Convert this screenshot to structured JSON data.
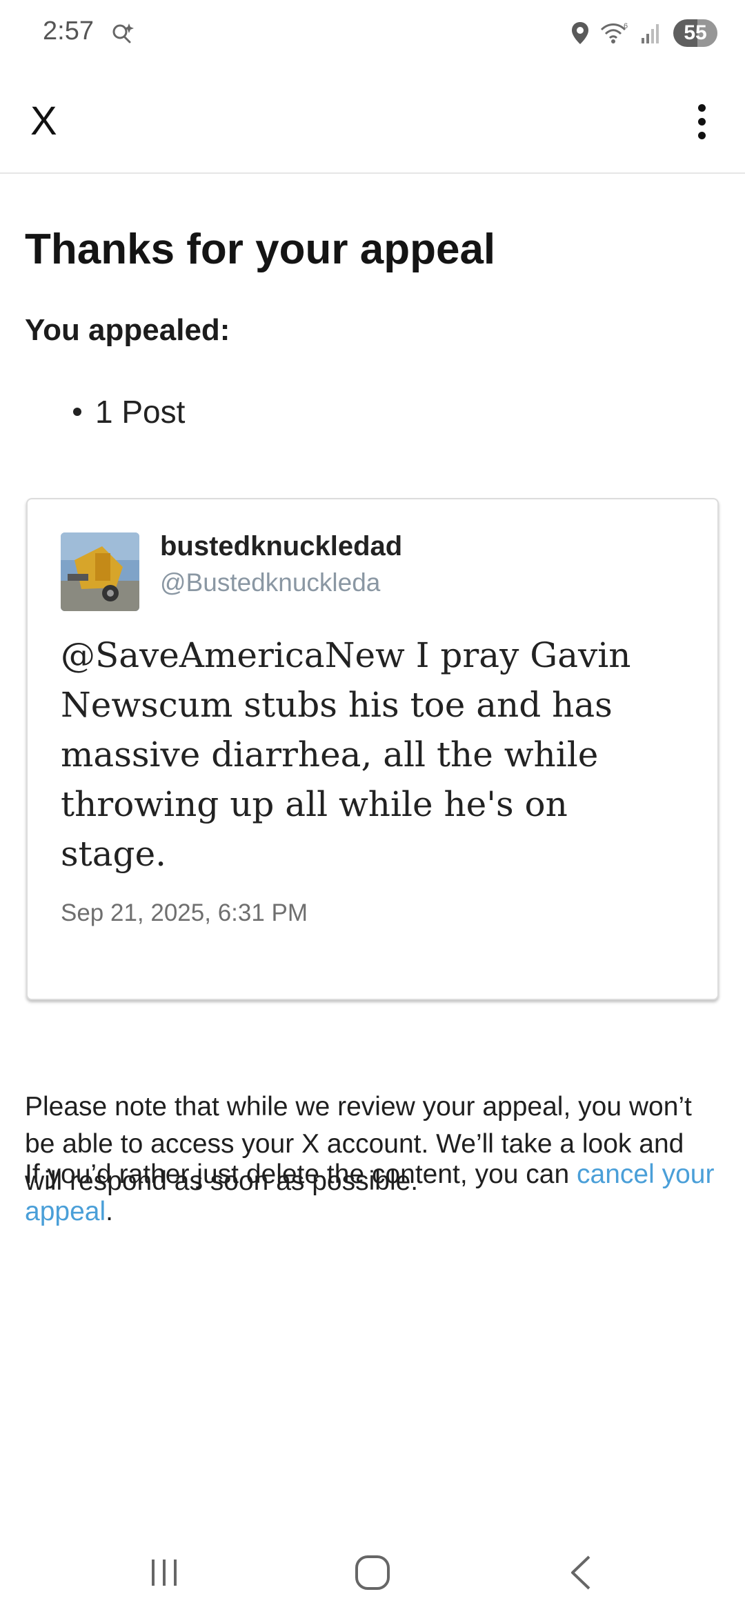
{
  "status_bar": {
    "time": "2:57",
    "battery": "55",
    "icons": [
      "search-sparkle-icon",
      "location-icon",
      "wifi-icon",
      "signal-icon",
      "battery-icon"
    ]
  },
  "app_bar": {
    "close_label": "X",
    "more_icon": "more-vertical-icon"
  },
  "main": {
    "title": "Thanks for your appeal",
    "appealed_label": "You appealed:",
    "appealed_items": [
      "1 Post"
    ],
    "post": {
      "display_name": "bustedknuckledad",
      "handle": "@Bustedknuckleda",
      "text": "@SaveAmericaNew I pray Gavin Newscum stubs his toe and has massive diarrhea, all the while throwing up all while he's on stage.",
      "timestamp": "Sep 21, 2025, 6:31 PM"
    },
    "note": "Please note that while we review your appeal, you won’t be able to access your X account. We’ll take a look and will respond as soon as possible.",
    "cancel_prefix": "If you’d rather just delete the content, you can ",
    "cancel_link": "cancel your appeal",
    "cancel_suffix": "."
  },
  "nav_bar": {
    "icons": [
      "recent-apps-icon",
      "home-icon",
      "back-icon"
    ]
  },
  "colors": {
    "link": "#4a9fd8",
    "handle": "#8a97a3",
    "text": "#1a1a1a"
  }
}
